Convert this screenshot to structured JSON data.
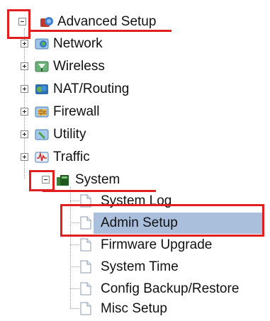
{
  "tree": {
    "root": {
      "label": "Advanced Setup",
      "expanded": true,
      "icon": "advanced-setup-icon",
      "children": [
        {
          "label": "Network",
          "icon": "network-globe-icon",
          "expanded": false
        },
        {
          "label": "Wireless",
          "icon": "wireless-antenna-icon",
          "expanded": false
        },
        {
          "label": "NAT/Routing",
          "icon": "nat-routing-icon",
          "expanded": false
        },
        {
          "label": "Firewall",
          "icon": "firewall-icon",
          "expanded": false
        },
        {
          "label": "Utility",
          "icon": "utility-icon",
          "expanded": false
        },
        {
          "label": "Traffic",
          "icon": "traffic-graph-icon",
          "expanded": false
        },
        {
          "label": "System",
          "icon": "system-icon",
          "expanded": true,
          "children": [
            {
              "label": "System Log",
              "icon": "page-icon"
            },
            {
              "label": "Admin Setup",
              "icon": "page-icon",
              "selected": true
            },
            {
              "label": "Firmware Upgrade",
              "icon": "page-icon"
            },
            {
              "label": "System Time",
              "icon": "page-icon"
            },
            {
              "label": "Config Backup/Restore",
              "icon": "page-icon"
            },
            {
              "label": "Misc Setup",
              "icon": "page-icon"
            }
          ]
        }
      ]
    }
  },
  "colors": {
    "selection": "#aabfdc",
    "annotation_red": "#e02020"
  }
}
